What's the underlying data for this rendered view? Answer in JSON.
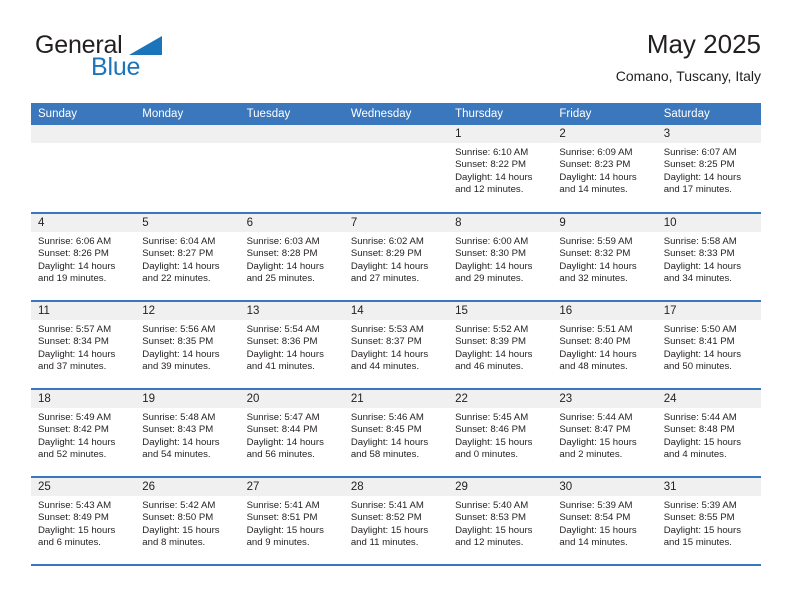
{
  "brand": {
    "name_top": "General",
    "name_bottom": "Blue",
    "accent_color": "#1b75bb",
    "triangle_icon": "brand-triangle-icon"
  },
  "header": {
    "title": "May 2025",
    "subtitle": "Comano, Tuscany, Italy"
  },
  "calendar": {
    "header_bg": "#3b77bc",
    "daynum_band_bg": "#f0f0f0",
    "weekdays": [
      "Sunday",
      "Monday",
      "Tuesday",
      "Wednesday",
      "Thursday",
      "Friday",
      "Saturday"
    ],
    "weeks": [
      [
        {
          "day": "",
          "empty": true
        },
        {
          "day": "",
          "empty": true
        },
        {
          "day": "",
          "empty": true
        },
        {
          "day": "",
          "empty": true
        },
        {
          "day": "1",
          "sunrise": "Sunrise: 6:10 AM",
          "sunset": "Sunset: 8:22 PM",
          "daylight_1": "Daylight: 14 hours",
          "daylight_2": "and 12 minutes."
        },
        {
          "day": "2",
          "sunrise": "Sunrise: 6:09 AM",
          "sunset": "Sunset: 8:23 PM",
          "daylight_1": "Daylight: 14 hours",
          "daylight_2": "and 14 minutes."
        },
        {
          "day": "3",
          "sunrise": "Sunrise: 6:07 AM",
          "sunset": "Sunset: 8:25 PM",
          "daylight_1": "Daylight: 14 hours",
          "daylight_2": "and 17 minutes."
        }
      ],
      [
        {
          "day": "4",
          "sunrise": "Sunrise: 6:06 AM",
          "sunset": "Sunset: 8:26 PM",
          "daylight_1": "Daylight: 14 hours",
          "daylight_2": "and 19 minutes."
        },
        {
          "day": "5",
          "sunrise": "Sunrise: 6:04 AM",
          "sunset": "Sunset: 8:27 PM",
          "daylight_1": "Daylight: 14 hours",
          "daylight_2": "and 22 minutes."
        },
        {
          "day": "6",
          "sunrise": "Sunrise: 6:03 AM",
          "sunset": "Sunset: 8:28 PM",
          "daylight_1": "Daylight: 14 hours",
          "daylight_2": "and 25 minutes."
        },
        {
          "day": "7",
          "sunrise": "Sunrise: 6:02 AM",
          "sunset": "Sunset: 8:29 PM",
          "daylight_1": "Daylight: 14 hours",
          "daylight_2": "and 27 minutes."
        },
        {
          "day": "8",
          "sunrise": "Sunrise: 6:00 AM",
          "sunset": "Sunset: 8:30 PM",
          "daylight_1": "Daylight: 14 hours",
          "daylight_2": "and 29 minutes."
        },
        {
          "day": "9",
          "sunrise": "Sunrise: 5:59 AM",
          "sunset": "Sunset: 8:32 PM",
          "daylight_1": "Daylight: 14 hours",
          "daylight_2": "and 32 minutes."
        },
        {
          "day": "10",
          "sunrise": "Sunrise: 5:58 AM",
          "sunset": "Sunset: 8:33 PM",
          "daylight_1": "Daylight: 14 hours",
          "daylight_2": "and 34 minutes."
        }
      ],
      [
        {
          "day": "11",
          "sunrise": "Sunrise: 5:57 AM",
          "sunset": "Sunset: 8:34 PM",
          "daylight_1": "Daylight: 14 hours",
          "daylight_2": "and 37 minutes."
        },
        {
          "day": "12",
          "sunrise": "Sunrise: 5:56 AM",
          "sunset": "Sunset: 8:35 PM",
          "daylight_1": "Daylight: 14 hours",
          "daylight_2": "and 39 minutes."
        },
        {
          "day": "13",
          "sunrise": "Sunrise: 5:54 AM",
          "sunset": "Sunset: 8:36 PM",
          "daylight_1": "Daylight: 14 hours",
          "daylight_2": "and 41 minutes."
        },
        {
          "day": "14",
          "sunrise": "Sunrise: 5:53 AM",
          "sunset": "Sunset: 8:37 PM",
          "daylight_1": "Daylight: 14 hours",
          "daylight_2": "and 44 minutes."
        },
        {
          "day": "15",
          "sunrise": "Sunrise: 5:52 AM",
          "sunset": "Sunset: 8:39 PM",
          "daylight_1": "Daylight: 14 hours",
          "daylight_2": "and 46 minutes."
        },
        {
          "day": "16",
          "sunrise": "Sunrise: 5:51 AM",
          "sunset": "Sunset: 8:40 PM",
          "daylight_1": "Daylight: 14 hours",
          "daylight_2": "and 48 minutes."
        },
        {
          "day": "17",
          "sunrise": "Sunrise: 5:50 AM",
          "sunset": "Sunset: 8:41 PM",
          "daylight_1": "Daylight: 14 hours",
          "daylight_2": "and 50 minutes."
        }
      ],
      [
        {
          "day": "18",
          "sunrise": "Sunrise: 5:49 AM",
          "sunset": "Sunset: 8:42 PM",
          "daylight_1": "Daylight: 14 hours",
          "daylight_2": "and 52 minutes."
        },
        {
          "day": "19",
          "sunrise": "Sunrise: 5:48 AM",
          "sunset": "Sunset: 8:43 PM",
          "daylight_1": "Daylight: 14 hours",
          "daylight_2": "and 54 minutes."
        },
        {
          "day": "20",
          "sunrise": "Sunrise: 5:47 AM",
          "sunset": "Sunset: 8:44 PM",
          "daylight_1": "Daylight: 14 hours",
          "daylight_2": "and 56 minutes."
        },
        {
          "day": "21",
          "sunrise": "Sunrise: 5:46 AM",
          "sunset": "Sunset: 8:45 PM",
          "daylight_1": "Daylight: 14 hours",
          "daylight_2": "and 58 minutes."
        },
        {
          "day": "22",
          "sunrise": "Sunrise: 5:45 AM",
          "sunset": "Sunset: 8:46 PM",
          "daylight_1": "Daylight: 15 hours",
          "daylight_2": "and 0 minutes."
        },
        {
          "day": "23",
          "sunrise": "Sunrise: 5:44 AM",
          "sunset": "Sunset: 8:47 PM",
          "daylight_1": "Daylight: 15 hours",
          "daylight_2": "and 2 minutes."
        },
        {
          "day": "24",
          "sunrise": "Sunrise: 5:44 AM",
          "sunset": "Sunset: 8:48 PM",
          "daylight_1": "Daylight: 15 hours",
          "daylight_2": "and 4 minutes."
        }
      ],
      [
        {
          "day": "25",
          "sunrise": "Sunrise: 5:43 AM",
          "sunset": "Sunset: 8:49 PM",
          "daylight_1": "Daylight: 15 hours",
          "daylight_2": "and 6 minutes."
        },
        {
          "day": "26",
          "sunrise": "Sunrise: 5:42 AM",
          "sunset": "Sunset: 8:50 PM",
          "daylight_1": "Daylight: 15 hours",
          "daylight_2": "and 8 minutes."
        },
        {
          "day": "27",
          "sunrise": "Sunrise: 5:41 AM",
          "sunset": "Sunset: 8:51 PM",
          "daylight_1": "Daylight: 15 hours",
          "daylight_2": "and 9 minutes."
        },
        {
          "day": "28",
          "sunrise": "Sunrise: 5:41 AM",
          "sunset": "Sunset: 8:52 PM",
          "daylight_1": "Daylight: 15 hours",
          "daylight_2": "and 11 minutes."
        },
        {
          "day": "29",
          "sunrise": "Sunrise: 5:40 AM",
          "sunset": "Sunset: 8:53 PM",
          "daylight_1": "Daylight: 15 hours",
          "daylight_2": "and 12 minutes."
        },
        {
          "day": "30",
          "sunrise": "Sunrise: 5:39 AM",
          "sunset": "Sunset: 8:54 PM",
          "daylight_1": "Daylight: 15 hours",
          "daylight_2": "and 14 minutes."
        },
        {
          "day": "31",
          "sunrise": "Sunrise: 5:39 AM",
          "sunset": "Sunset: 8:55 PM",
          "daylight_1": "Daylight: 15 hours",
          "daylight_2": "and 15 minutes."
        }
      ]
    ]
  }
}
